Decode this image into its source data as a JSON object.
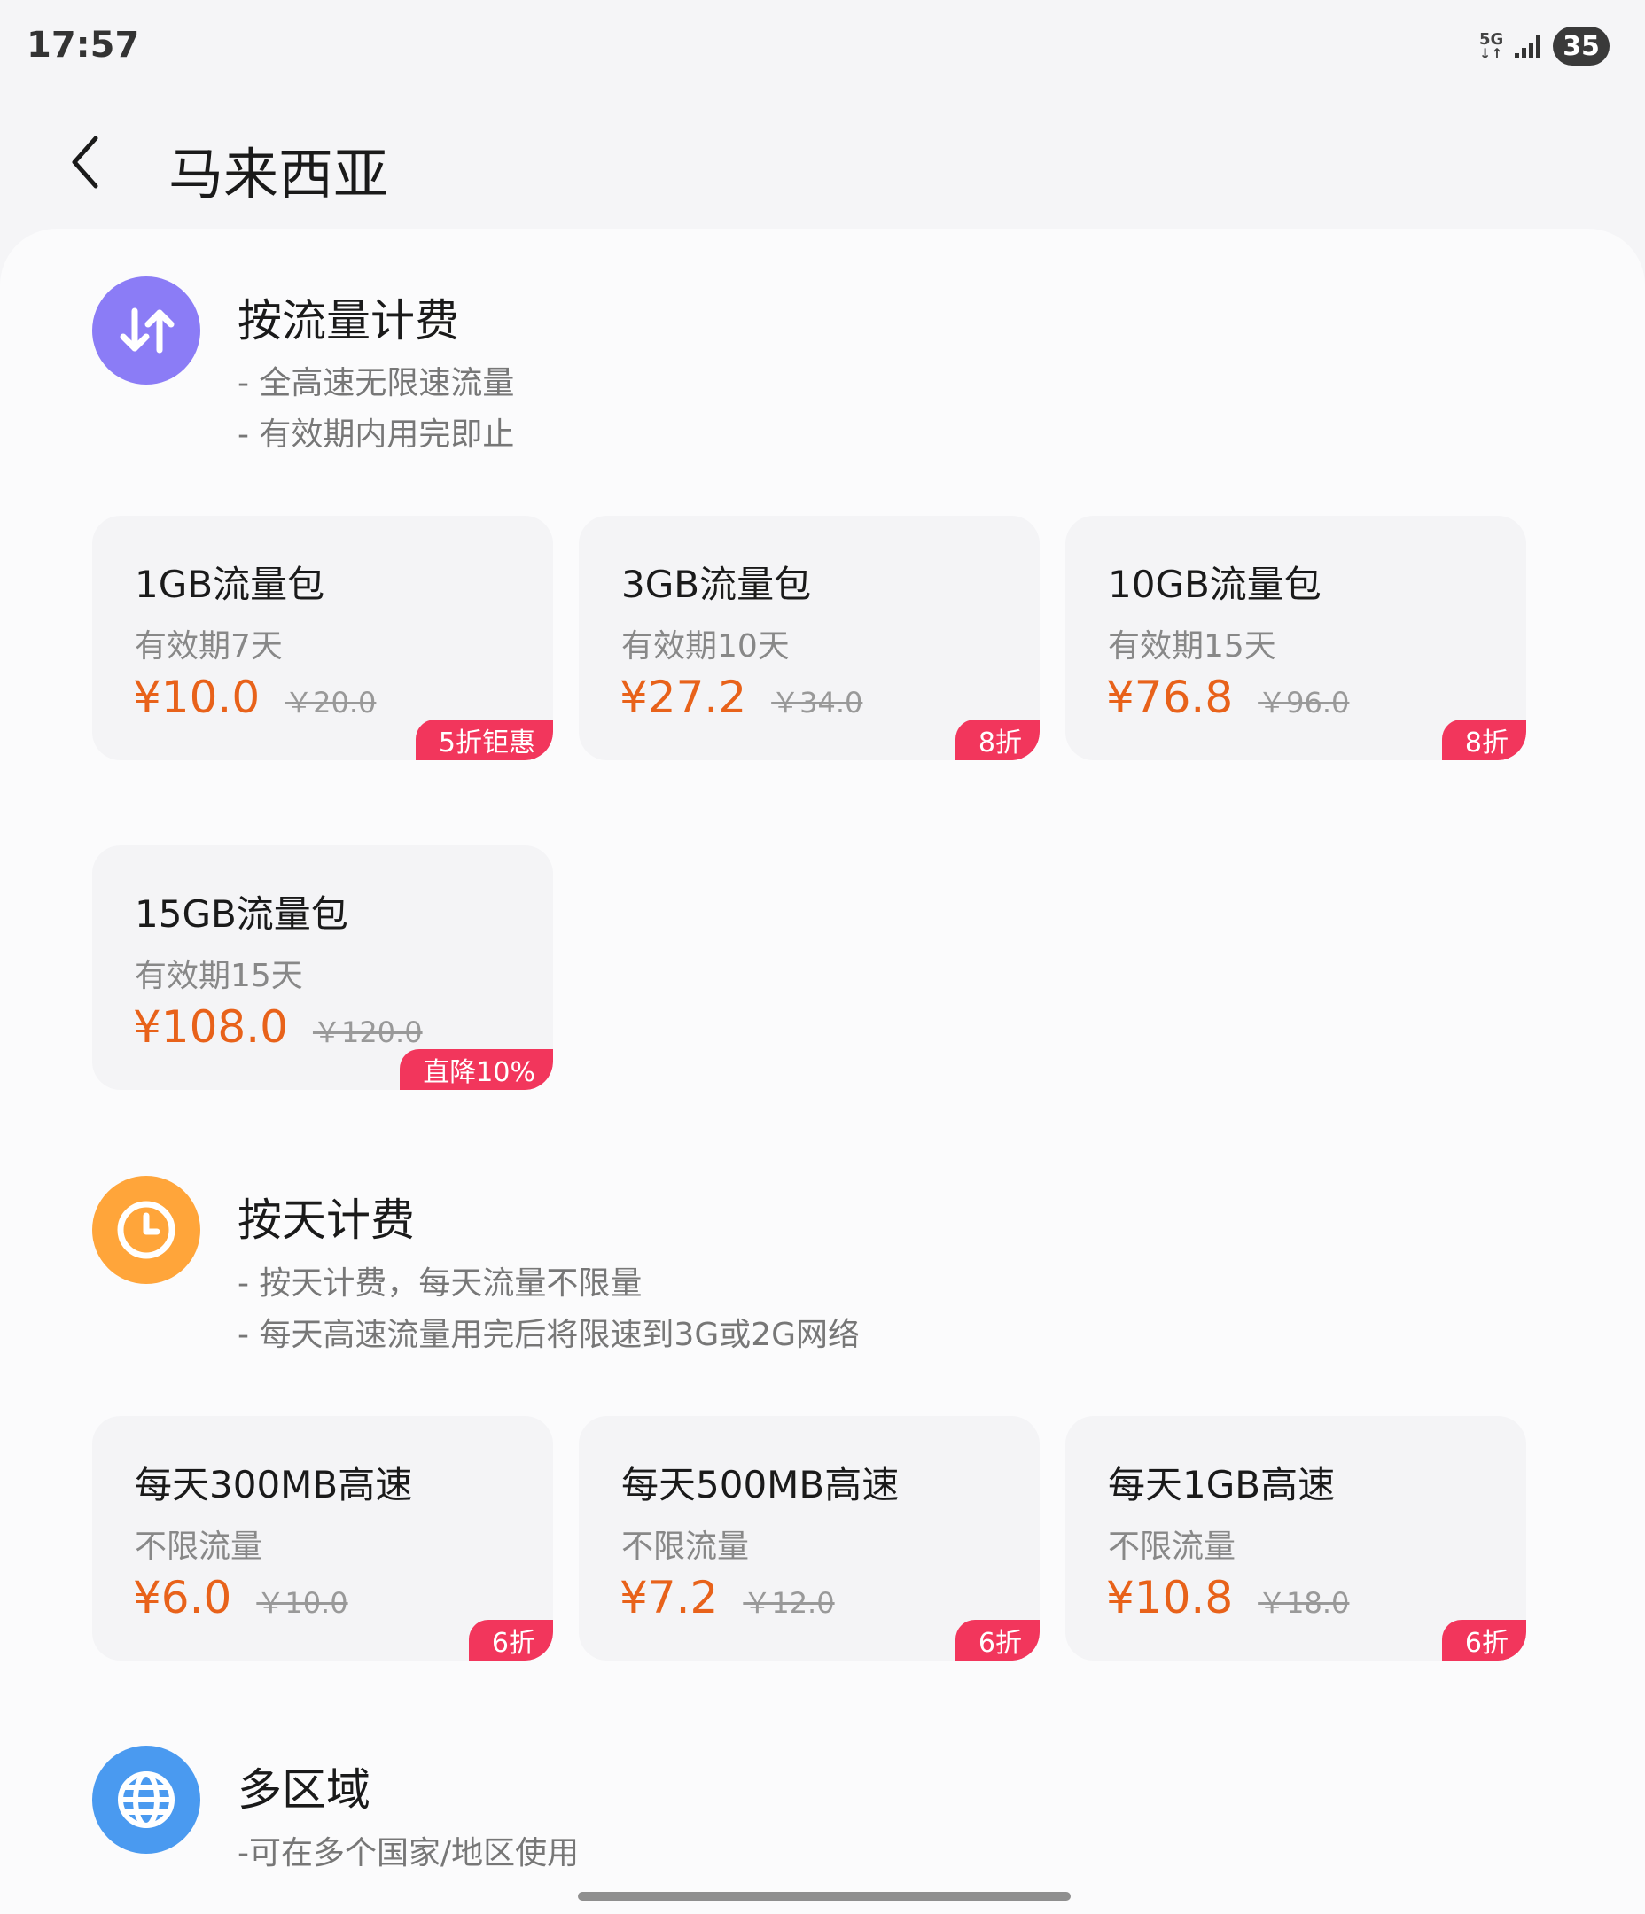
{
  "status_bar": {
    "time": "17:57",
    "network": "5G",
    "battery": "35"
  },
  "header": {
    "title": "马来西亚"
  },
  "sections": [
    {
      "title": "按流量计费",
      "desc": [
        "- 全高速无限速流量",
        "- 有效期内用完即止"
      ],
      "icon": "up-down-arrows-icon",
      "color": "#8b7cf6",
      "cards": [
        {
          "name": "1GB流量包",
          "sub": "有效期7天",
          "price": "¥10.0",
          "orig": "￥20.0",
          "tag": "5折钜惠"
        },
        {
          "name": "3GB流量包",
          "sub": "有效期10天",
          "price": "¥27.2",
          "orig": "￥34.0",
          "tag": "8折"
        },
        {
          "name": "10GB流量包",
          "sub": "有效期15天",
          "price": "¥76.8",
          "orig": "￥96.0",
          "tag": "8折"
        },
        {
          "name": "15GB流量包",
          "sub": "有效期15天",
          "price": "¥108.0",
          "orig": "￥120.0",
          "tag": "直降10%"
        }
      ]
    },
    {
      "title": "按天计费",
      "desc": [
        "- 按天计费，每天流量不限量",
        "- 每天高速流量用完后将限速到3G或2G网络"
      ],
      "icon": "clock-icon",
      "color": "#ffa53a",
      "cards": [
        {
          "name": "每天300MB高速",
          "sub": "不限流量",
          "price": "¥6.0",
          "orig": "￥10.0",
          "tag": "6折"
        },
        {
          "name": "每天500MB高速",
          "sub": "不限流量",
          "price": "¥7.2",
          "orig": "￥12.0",
          "tag": "6折"
        },
        {
          "name": "每天1GB高速",
          "sub": "不限流量",
          "price": "¥10.8",
          "orig": "￥18.0",
          "tag": "6折"
        }
      ]
    },
    {
      "title": "多区域",
      "desc": [
        "-可在多个国家/地区使用"
      ],
      "icon": "globe-icon",
      "color": "#4a9af0"
    }
  ],
  "colors": {
    "price": "#e8621a",
    "tag": "#f2365c"
  }
}
